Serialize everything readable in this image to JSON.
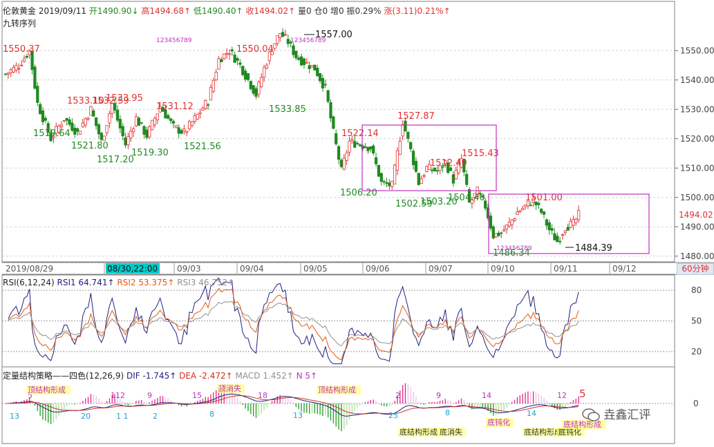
{
  "header": {
    "symbol": "伦敦黄金",
    "date": "2019/09/11",
    "open_label": "开",
    "open": "1490.90",
    "open_arrow": "↓",
    "high_label": "高",
    "high": "1494.68",
    "high_arrow": "↑",
    "low_label": "低",
    "low": "1490.40",
    "low_arrow": "↑",
    "close_label": "收",
    "close": "1494.02",
    "close_arrow": "↑",
    "volume_label": "量",
    "volume": "0",
    "oi_label": "仓",
    "oi": "0",
    "incr_label": "增",
    "incr": "0",
    "amp_label": "振",
    "amp": "0.29%",
    "chg_label": "涨",
    "chg": "(3.11)0.21%",
    "chg_arrow": "↑"
  },
  "indicator_title": "九转序列",
  "period": "60分钟",
  "colors": {
    "up": "#e03030",
    "down": "#208a20",
    "box": "#c030c0",
    "rsi1": "#202080",
    "rsi2": "#e05a10",
    "rsi3": "#909090",
    "dif": "#202080",
    "dea": "#d03020",
    "highlight": "#00cccc"
  },
  "chart_data": [
    {
      "type": "candlestick",
      "x_labels": [
        "2019/08/29",
        "08/30,22:00",
        "09/03",
        "09/04",
        "09/05",
        "09/06",
        "09/07",
        "09/10",
        "09/11",
        "09/12"
      ],
      "highlighted_x_label": "08/30,22:00",
      "y_ticks": [
        1480,
        1490,
        1500,
        1510,
        1520,
        1530,
        1540,
        1550
      ],
      "ylim": [
        1479,
        1563
      ],
      "last_price": "1494.02",
      "peaks_labels": [
        {
          "text": "1550.37",
          "price": 1550.37,
          "kind": "high"
        },
        {
          "text": "1519.64",
          "price": 1519.64,
          "kind": "low"
        },
        {
          "text": "1533.10",
          "price": 1533.1,
          "kind": "high"
        },
        {
          "text": "1521.80",
          "price": 1521.8,
          "kind": "low"
        },
        {
          "text": "1532.59",
          "price": 1532.59,
          "kind": "high"
        },
        {
          "text": "1533.95",
          "price": 1533.95,
          "kind": "high"
        },
        {
          "text": "1517.20",
          "price": 1517.2,
          "kind": "low"
        },
        {
          "text": "1519.30",
          "price": 1519.3,
          "kind": "low"
        },
        {
          "text": "1531.12",
          "price": 1531.12,
          "kind": "high"
        },
        {
          "text": "1521.56",
          "price": 1521.56,
          "kind": "low"
        },
        {
          "text": "1550.04",
          "price": 1550.04,
          "kind": "high"
        },
        {
          "text": "1533.85",
          "price": 1533.85,
          "kind": "low"
        },
        {
          "text": "1557.00",
          "price": 1557.0,
          "kind": "peak"
        },
        {
          "text": "1522.14",
          "price": 1522.14,
          "kind": "high"
        },
        {
          "text": "1506.20",
          "price": 1506.2,
          "kind": "low"
        },
        {
          "text": "1527.87",
          "price": 1527.87,
          "kind": "high"
        },
        {
          "text": "1502.59",
          "price": 1502.59,
          "kind": "low"
        },
        {
          "text": "1512.49",
          "price": 1512.49,
          "kind": "high"
        },
        {
          "text": "1503.20",
          "price": 1503.2,
          "kind": "low"
        },
        {
          "text": "1515.43",
          "price": 1515.43,
          "kind": "high"
        },
        {
          "text": "1504.40",
          "price": 1504.4,
          "kind": "low"
        },
        {
          "text": "1501.00",
          "price": 1501.0,
          "kind": "high"
        },
        {
          "text": "1486.34",
          "price": 1486.34,
          "kind": "low"
        },
        {
          "text": "1484.39",
          "price": 1484.39,
          "kind": "peak"
        }
      ],
      "td_seq_marks": [
        "123456789",
        "123456789",
        "123456789"
      ],
      "anchors": [
        {
          "bar": 0,
          "price": 1542
        },
        {
          "bar": 5,
          "price": 1545
        },
        {
          "bar": 9,
          "price": 1550
        },
        {
          "bar": 12,
          "price": 1532
        },
        {
          "bar": 17,
          "price": 1520
        },
        {
          "bar": 22,
          "price": 1527
        },
        {
          "bar": 27,
          "price": 1522
        },
        {
          "bar": 32,
          "price": 1530
        },
        {
          "bar": 36,
          "price": 1519
        },
        {
          "bar": 40,
          "price": 1532
        },
        {
          "bar": 45,
          "price": 1518
        },
        {
          "bar": 49,
          "price": 1527
        },
        {
          "bar": 53,
          "price": 1521
        },
        {
          "bar": 58,
          "price": 1531
        },
        {
          "bar": 63,
          "price": 1524
        },
        {
          "bar": 67,
          "price": 1522
        },
        {
          "bar": 72,
          "price": 1528
        },
        {
          "bar": 76,
          "price": 1533
        },
        {
          "bar": 80,
          "price": 1547
        },
        {
          "bar": 84,
          "price": 1550
        },
        {
          "bar": 88,
          "price": 1545
        },
        {
          "bar": 91,
          "price": 1540
        },
        {
          "bar": 94,
          "price": 1535
        },
        {
          "bar": 97,
          "price": 1544
        },
        {
          "bar": 100,
          "price": 1551
        },
        {
          "bar": 103,
          "price": 1556
        },
        {
          "bar": 106,
          "price": 1553
        },
        {
          "bar": 109,
          "price": 1548
        },
        {
          "bar": 112,
          "price": 1546
        },
        {
          "bar": 116,
          "price": 1544
        },
        {
          "bar": 120,
          "price": 1537
        },
        {
          "bar": 123,
          "price": 1522
        },
        {
          "bar": 126,
          "price": 1509
        },
        {
          "bar": 129,
          "price": 1519
        },
        {
          "bar": 133,
          "price": 1518
        },
        {
          "bar": 137,
          "price": 1517
        },
        {
          "bar": 141,
          "price": 1505
        },
        {
          "bar": 145,
          "price": 1504
        },
        {
          "bar": 149,
          "price": 1526
        },
        {
          "bar": 152,
          "price": 1516
        },
        {
          "bar": 155,
          "price": 1505
        },
        {
          "bar": 158,
          "price": 1510
        },
        {
          "bar": 162,
          "price": 1509
        },
        {
          "bar": 165,
          "price": 1512
        },
        {
          "bar": 168,
          "price": 1506
        },
        {
          "bar": 171,
          "price": 1513
        },
        {
          "bar": 174,
          "price": 1498
        },
        {
          "bar": 177,
          "price": 1502
        },
        {
          "bar": 180,
          "price": 1497
        },
        {
          "bar": 183,
          "price": 1487
        },
        {
          "bar": 186,
          "price": 1488
        },
        {
          "bar": 189,
          "price": 1491
        },
        {
          "bar": 192,
          "price": 1495
        },
        {
          "bar": 195,
          "price": 1497
        },
        {
          "bar": 198,
          "price": 1499
        },
        {
          "bar": 201,
          "price": 1495
        },
        {
          "bar": 204,
          "price": 1489
        },
        {
          "bar": 207,
          "price": 1485
        },
        {
          "bar": 210,
          "price": 1490
        },
        {
          "bar": 213,
          "price": 1491
        },
        {
          "bar": 215,
          "price": 1494
        }
      ]
    },
    {
      "type": "line",
      "name": "RSI",
      "title": "RSI(6,12,24)",
      "series": [
        {
          "name": "RSI1",
          "value": "64.741",
          "arrow": "↑"
        },
        {
          "name": "RSI2",
          "value": "53.375",
          "arrow": "↑"
        },
        {
          "name": "RSI3",
          "value": "46.752",
          "arrow": "↑"
        }
      ],
      "y_ticks": [
        20,
        50,
        80
      ],
      "ylim": [
        5,
        95
      ]
    },
    {
      "type": "bar",
      "name": "MACD",
      "title": "定量结构策略——四色(12,26,9)",
      "series": [
        {
          "name": "DIF",
          "value": "-1.745",
          "arrow": "↑"
        },
        {
          "name": "DEA",
          "value": "-2.472",
          "arrow": "↑"
        },
        {
          "name": "MACD",
          "value": "1.452",
          "arrow": "↑"
        },
        {
          "name": "N",
          "value": "5",
          "arrow": "↑"
        }
      ],
      "y_ticks": [
        0
      ],
      "counts_top": [
        "5",
        "112",
        "9",
        "15",
        "18",
        "2",
        "9",
        "14",
        "12"
      ],
      "counts_bottom": [
        "13",
        "20",
        "1 1",
        "2",
        "8",
        "13",
        "25",
        "8",
        "14"
      ],
      "signals": [
        "顶结构形成",
        "顶消失",
        "顶结构形成",
        "底结构形成",
        "底消失",
        "底钝化",
        "底结构形成",
        "底钝化",
        "底结构形成"
      ],
      "last_n": "5"
    }
  ],
  "watermark": {
    "icon": "wechat-icon",
    "text": "垚鑫汇评"
  }
}
